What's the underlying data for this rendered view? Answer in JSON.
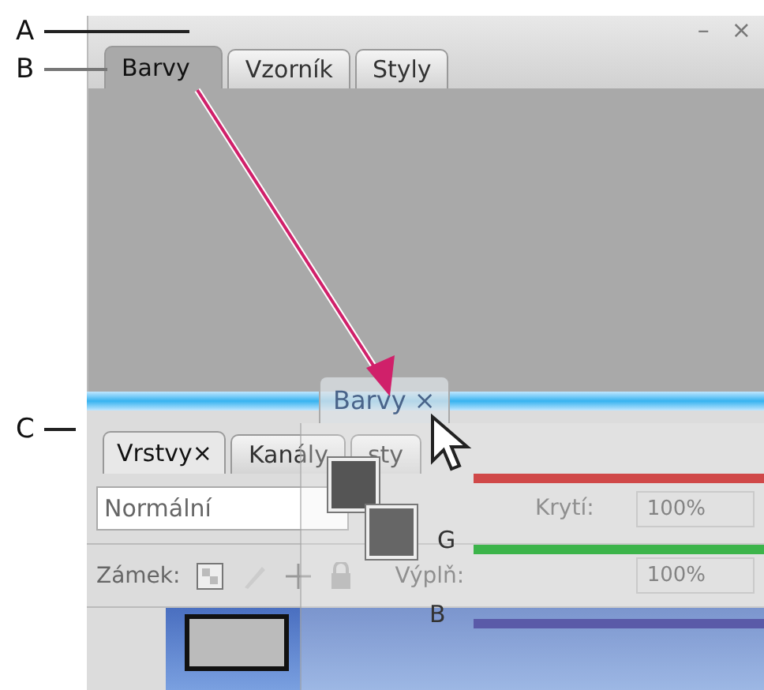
{
  "callouts": [
    {
      "label": "A"
    },
    {
      "label": "B"
    },
    {
      "label": "C"
    }
  ],
  "top_panel": {
    "minimize": "–",
    "close": "×",
    "tabs": [
      {
        "label": "Barvy",
        "selected": true
      },
      {
        "label": "Vzorník",
        "selected": false
      },
      {
        "label": "Styly",
        "selected": false
      }
    ]
  },
  "bottom_panel": {
    "tabs": [
      {
        "label": "Vrstvy",
        "close": "×",
        "selected": true
      },
      {
        "label": "Kanály",
        "selected": false
      },
      {
        "label": "sty",
        "selected": false
      }
    ],
    "blend_mode": "Normální",
    "opacity_label": "Krytí:",
    "opacity": "100%",
    "lock_label": "Zámek:",
    "fill_label": "Výplň:",
    "fill": "100%"
  },
  "drag_tab": {
    "label": "Barvy",
    "close": "×"
  },
  "color_panel": {
    "sliders": [
      {
        "color": "#d04848"
      },
      {
        "name": "G",
        "color": "#3cb44a"
      },
      {
        "name": "B",
        "color": "#5a5aa8"
      }
    ]
  }
}
